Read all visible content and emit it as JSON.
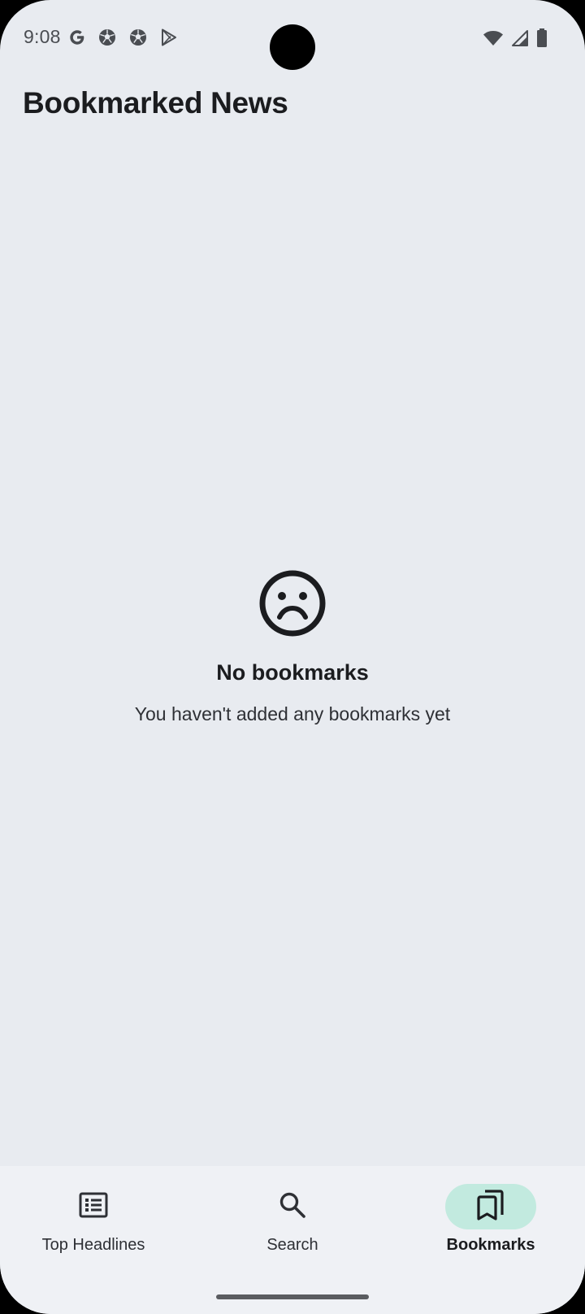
{
  "status_bar": {
    "time": "9:08",
    "left_icons": [
      "google-icon",
      "soccer-ball-icon",
      "soccer-ball-icon",
      "play-store-icon"
    ],
    "right_icons": [
      "wifi-icon",
      "cell-signal-icon",
      "battery-icon"
    ]
  },
  "app_bar": {
    "title": "Bookmarked News"
  },
  "empty_state": {
    "icon": "sad-face-icon",
    "title": "No bookmarks",
    "subtitle": "You haven't added any bookmarks yet"
  },
  "bottom_nav": {
    "items": [
      {
        "label": "Top Headlines",
        "icon": "newspaper-icon",
        "active": false
      },
      {
        "label": "Search",
        "icon": "search-icon",
        "active": false
      },
      {
        "label": "Bookmarks",
        "icon": "bookmarks-icon",
        "active": true
      }
    ]
  },
  "colors": {
    "background": "#e8ebf0",
    "nav_background": "#eff1f5",
    "active_pill": "#c2eadf",
    "text_primary": "#1b1c1f"
  }
}
